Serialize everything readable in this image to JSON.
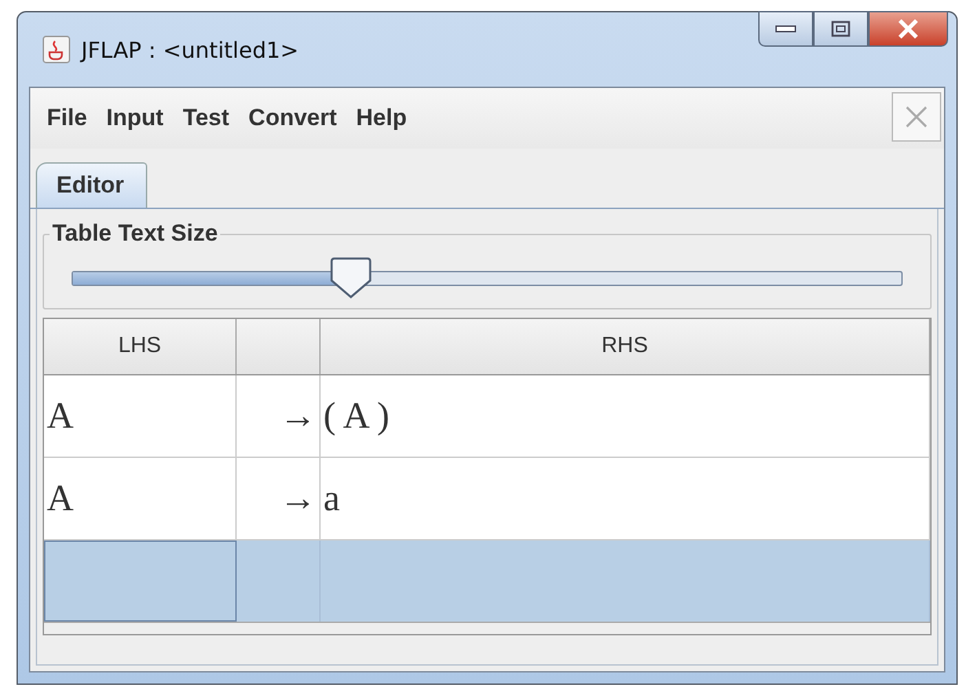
{
  "window": {
    "title": "JFLAP : <untitled1>"
  },
  "menu": [
    "File",
    "Input",
    "Test",
    "Convert",
    "Help"
  ],
  "tabs": [
    {
      "label": "Editor",
      "selected": true
    }
  ],
  "slider": {
    "label": "Table Text Size",
    "level": 0.335
  },
  "table": {
    "columns": [
      "LHS",
      "RHS"
    ],
    "rows": [
      {
        "lhs": "A",
        "arrow": "→",
        "rhs": "( A )",
        "selected": false
      },
      {
        "lhs": "A",
        "arrow": "→",
        "rhs": "a",
        "selected": false
      },
      {
        "selected": true
      }
    ]
  }
}
